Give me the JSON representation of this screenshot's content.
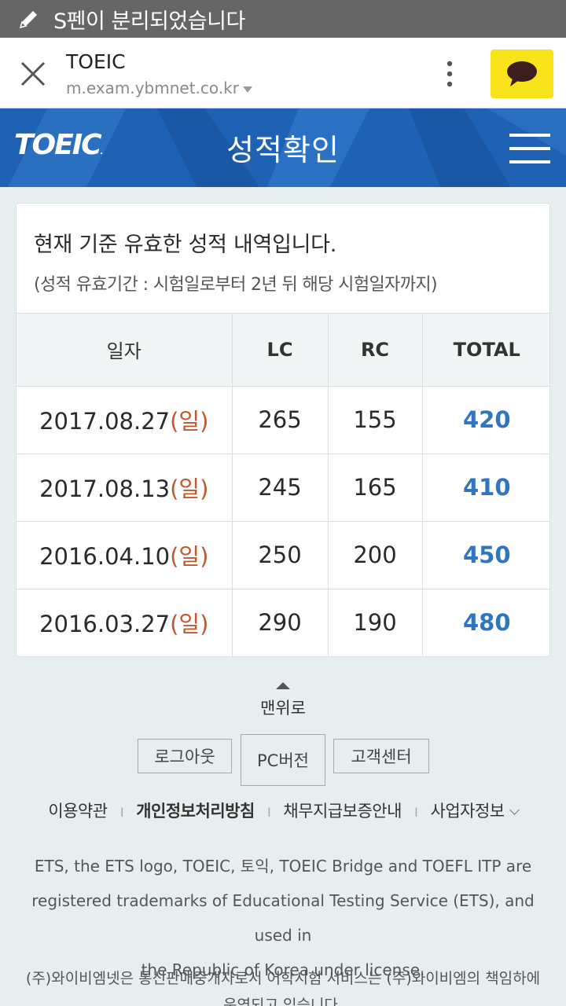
{
  "status_bar": {
    "message": "S펜이 분리되었습니다"
  },
  "browser": {
    "title": "TOEIC",
    "url": "m.exam.ybmnet.co.kr"
  },
  "header": {
    "logo": "TOEIC",
    "title": "성적확인"
  },
  "intro": {
    "heading": "현재 기준 유효한 성적 내역입니다.",
    "note": "(성적 유효기간 : 시험일로부터 2년 뒤 해당 시험일자까지)"
  },
  "table": {
    "headers": [
      "일자",
      "LC",
      "RC",
      "TOTAL"
    ],
    "rows": [
      {
        "date": "2017.08.27",
        "day": "(일)",
        "lc": "265",
        "rc": "155",
        "total": "420"
      },
      {
        "date": "2017.08.13",
        "day": "(일)",
        "lc": "245",
        "rc": "165",
        "total": "410"
      },
      {
        "date": "2016.04.10",
        "day": "(일)",
        "lc": "250",
        "rc": "200",
        "total": "450"
      },
      {
        "date": "2016.03.27",
        "day": "(일)",
        "lc": "290",
        "rc": "190",
        "total": "480"
      }
    ]
  },
  "footer": {
    "to_top": "맨위로",
    "buttons": [
      "로그아웃",
      "PC버전",
      "고객센터"
    ],
    "links": [
      "이용약관",
      "개인정보처리방침",
      "채무지급보증안내",
      "사업자정보"
    ],
    "legal_lines": [
      "ETS, the ETS logo, TOEIC, 토익, TOEIC Bridge and TOEFL ITP are",
      "registered trademarks of Educational Testing Service (ETS), and used in",
      "the Republic of Korea under license."
    ],
    "legal_kr_lines": [
      "(주)와이비엠넷은 통신판매중개자로서 어학시험 서비스는 (주)와이비엠의 책임하에",
      "운영되고 있습니다."
    ]
  },
  "colors": {
    "header_blue": "#1f62b4",
    "total_blue": "#2f76c2",
    "day_red": "#c2572b",
    "kakao_yellow": "#f8e21a"
  }
}
